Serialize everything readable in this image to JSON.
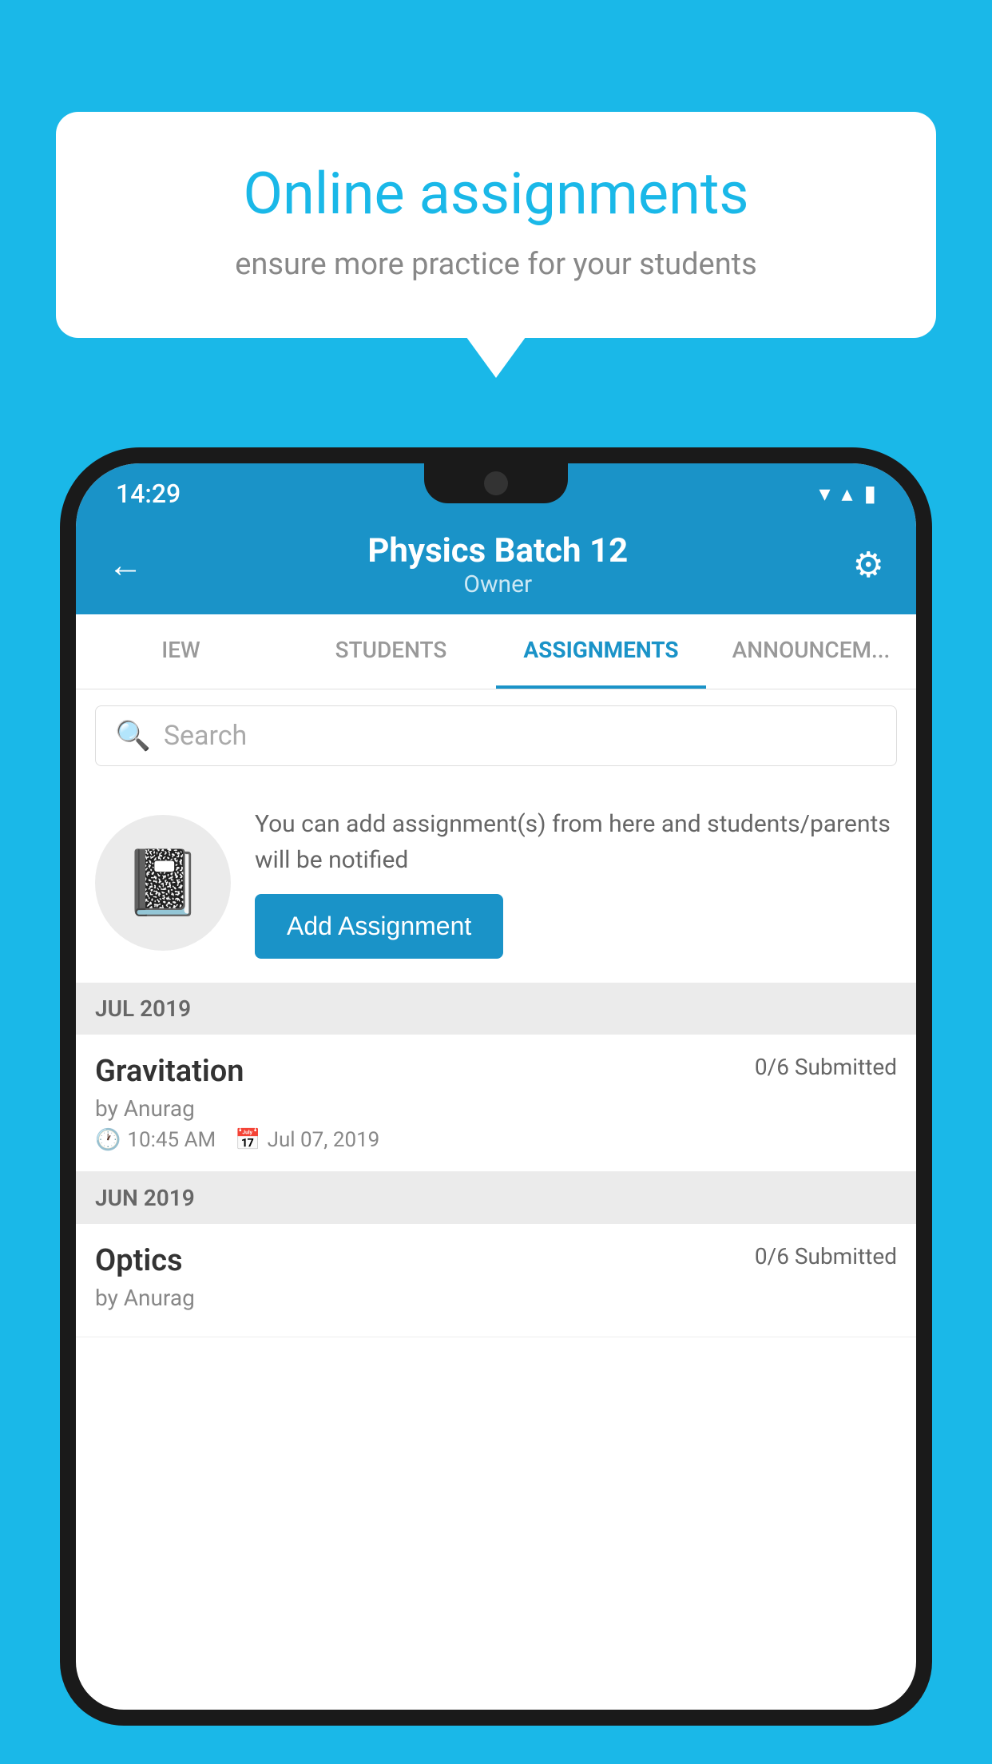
{
  "background": {
    "color": "#1ab8e8"
  },
  "bubble": {
    "title": "Online assignments",
    "subtitle": "ensure more practice for your students"
  },
  "status_bar": {
    "time": "14:29",
    "wifi": "▼",
    "signal": "▲",
    "battery": "▮"
  },
  "header": {
    "title": "Physics Batch 12",
    "subtitle": "Owner",
    "back_label": "←",
    "settings_label": "⚙"
  },
  "tabs": [
    {
      "label": "IEW",
      "active": false
    },
    {
      "label": "STUDENTS",
      "active": false
    },
    {
      "label": "ASSIGNMENTS",
      "active": true
    },
    {
      "label": "ANNOUNCEM...",
      "active": false
    }
  ],
  "search": {
    "placeholder": "Search"
  },
  "promo": {
    "text": "You can add assignment(s) from here and students/parents will be notified",
    "button_label": "Add Assignment"
  },
  "sections": [
    {
      "label": "JUL 2019",
      "assignments": [
        {
          "name": "Gravitation",
          "submitted": "0/6 Submitted",
          "by": "by Anurag",
          "time": "10:45 AM",
          "date": "Jul 07, 2019"
        }
      ]
    },
    {
      "label": "JUN 2019",
      "assignments": [
        {
          "name": "Optics",
          "submitted": "0/6 Submitted",
          "by": "by Anurag",
          "time": "",
          "date": ""
        }
      ]
    }
  ]
}
